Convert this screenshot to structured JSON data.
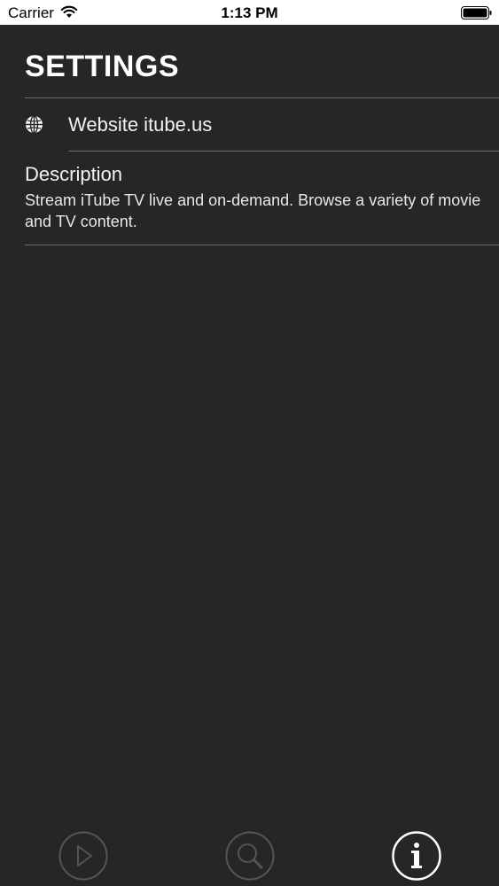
{
  "status_bar": {
    "carrier": "Carrier",
    "time": "1:13 PM"
  },
  "page": {
    "title": "SETTINGS"
  },
  "website": {
    "icon": "globe-icon",
    "label": "Website itube.us"
  },
  "description": {
    "title": "Description",
    "text": "Stream iTube TV live and on-demand. Browse a variety of movie and TV content."
  },
  "tab_bar": {
    "tabs": [
      {
        "icon": "play-icon",
        "selected": false
      },
      {
        "icon": "search-icon",
        "selected": false
      },
      {
        "icon": "info-icon",
        "selected": true
      }
    ],
    "active_color": "#ffffff",
    "inactive_color": "#555457"
  },
  "colors": {
    "background": "#262527",
    "divider": "#6b6a6e"
  }
}
